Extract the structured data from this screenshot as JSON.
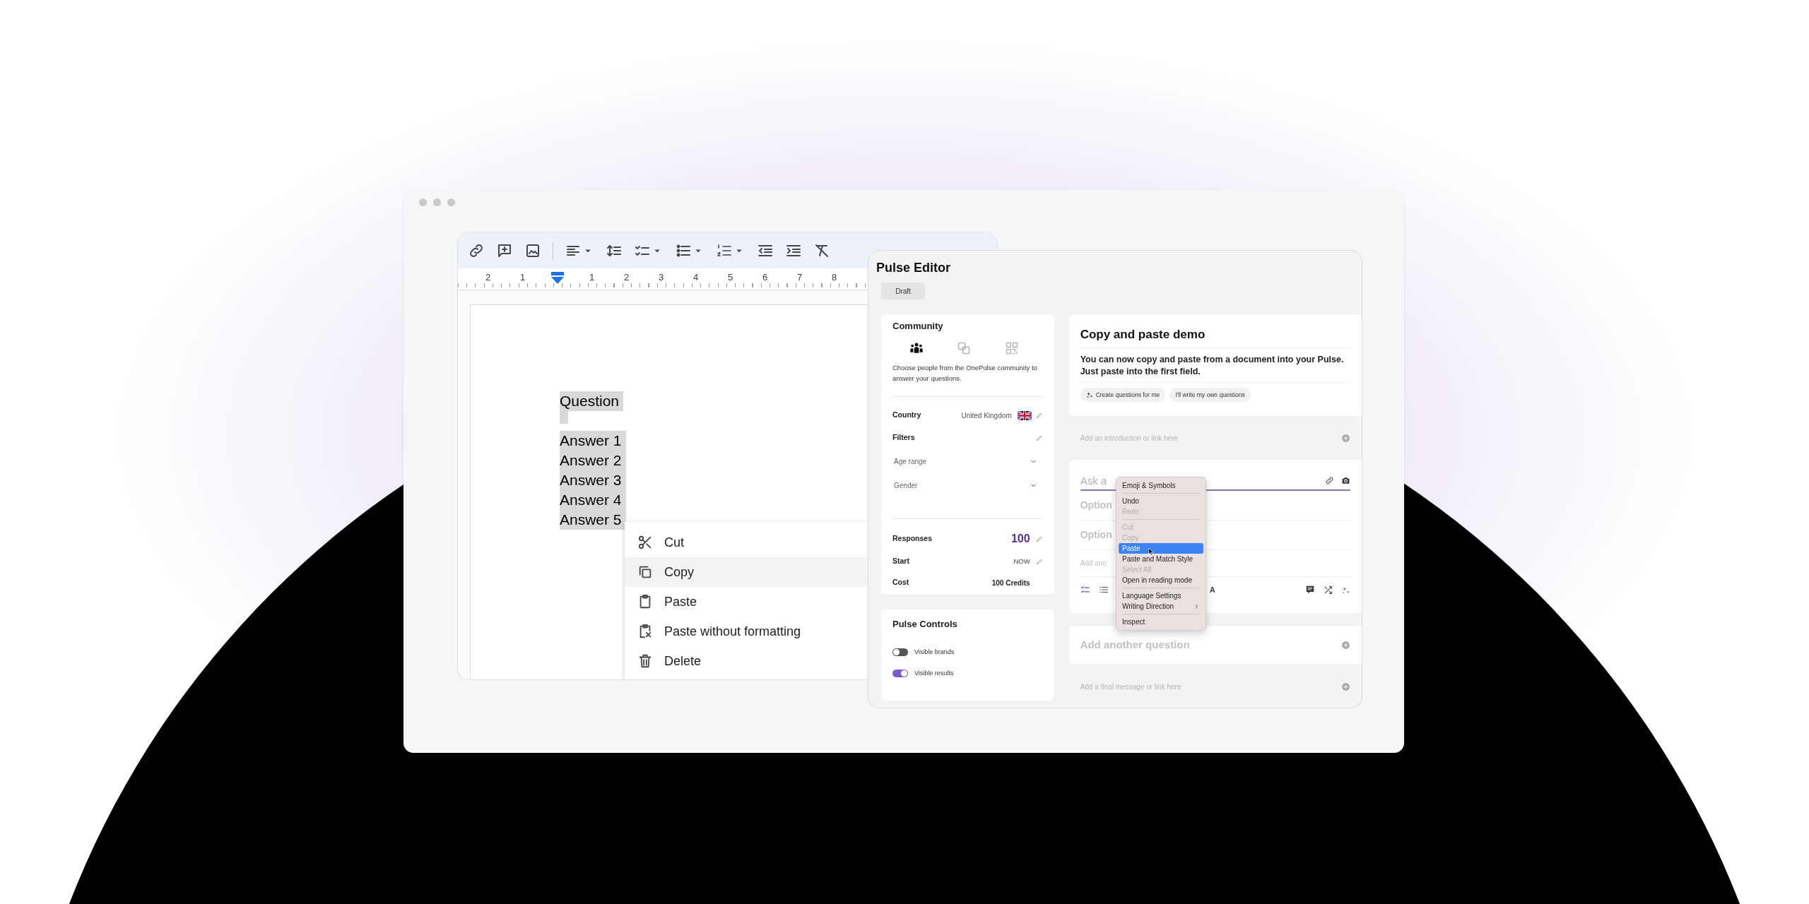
{
  "document": {
    "ruler_labels": [
      "2",
      "1",
      "1",
      "2",
      "3",
      "4",
      "5",
      "6",
      "7",
      "8"
    ],
    "selected": true,
    "question": "Question",
    "answers": [
      "Answer 1",
      "Answer 2",
      "Answer 3",
      "Answer 4",
      "Answer 5"
    ]
  },
  "doc_context_menu": [
    {
      "kind": "cut",
      "label": "Cut",
      "selected": false
    },
    {
      "kind": "copy",
      "label": "Copy",
      "selected": true
    },
    {
      "kind": "paste",
      "label": "Paste",
      "selected": false
    },
    {
      "kind": "paste_plain",
      "label": "Paste without formatting",
      "selected": false
    },
    {
      "kind": "delete",
      "label": "Delete",
      "selected": false
    }
  ],
  "pulse_editor": {
    "title": "Pulse Editor",
    "status": "Draft",
    "community": {
      "title": "Community",
      "audience_tabs": [
        {
          "kind": "community",
          "selected": true
        },
        {
          "kind": "link",
          "selected": false
        },
        {
          "kind": "qr",
          "selected": false
        }
      ],
      "description": "Choose people from the OnePulse community to answer your questions.",
      "country": {
        "label": "Country",
        "value": "United Kingdom"
      },
      "filters": {
        "label": "Filters",
        "dropdowns": [
          "Age range",
          "Gender"
        ]
      },
      "responses": {
        "label": "Responses",
        "value": "100"
      },
      "start": {
        "label": "Start",
        "value": "NOW"
      },
      "cost": {
        "label": "Cost",
        "value": "100 Credits"
      }
    },
    "controls": {
      "title": "Pulse Controls",
      "toggles": [
        {
          "label": "Visible brands",
          "on": false
        },
        {
          "label": "Visible results",
          "on": true
        }
      ]
    },
    "intro": {
      "title": "Copy and paste demo",
      "body": "You can now copy and paste from a document into your Pulse. Just paste into the first field.",
      "chips": [
        {
          "kind": "ai",
          "label": "Create questions for me"
        },
        {
          "kind": "plain",
          "label": "I'll write my own questions"
        }
      ],
      "placeholder": "Add an introduction or link here"
    },
    "question": {
      "placeholder": "Ask a",
      "options": [
        {
          "placeholder": "Option"
        },
        {
          "placeholder": "Option"
        }
      ],
      "add_option": {
        "placeholder": "Add ano"
      },
      "format_label": "A"
    },
    "add_question": "Add another question",
    "final_message": {
      "placeholder": "Add a final message or link here"
    }
  },
  "system_context_menu": {
    "groups": [
      {
        "items": [
          {
            "label": "Emoji & Symbols",
            "disabled": false,
            "selected": false,
            "submenu": false
          }
        ]
      },
      {
        "items": [
          {
            "label": "Undo",
            "disabled": false,
            "selected": false,
            "submenu": false
          },
          {
            "label": "Redo",
            "disabled": true,
            "selected": false,
            "submenu": false
          }
        ]
      },
      {
        "items": [
          {
            "label": "Cut",
            "disabled": true,
            "selected": false,
            "submenu": false
          },
          {
            "label": "Copy",
            "disabled": true,
            "selected": false,
            "submenu": false
          },
          {
            "label": "Paste",
            "disabled": false,
            "selected": true,
            "submenu": false
          },
          {
            "label": "Paste and Match Style",
            "disabled": false,
            "selected": false,
            "submenu": false
          },
          {
            "label": "Select All",
            "disabled": true,
            "selected": false,
            "submenu": false
          },
          {
            "label": "Open in reading mode",
            "disabled": false,
            "selected": false,
            "submenu": false
          }
        ]
      },
      {
        "items": [
          {
            "label": "Language Settings",
            "disabled": false,
            "selected": false,
            "submenu": false
          },
          {
            "label": "Writing Direction",
            "disabled": false,
            "selected": false,
            "submenu": true
          }
        ]
      },
      {
        "items": [
          {
            "label": "Inspect",
            "disabled": false,
            "selected": false,
            "submenu": false
          }
        ]
      }
    ]
  }
}
